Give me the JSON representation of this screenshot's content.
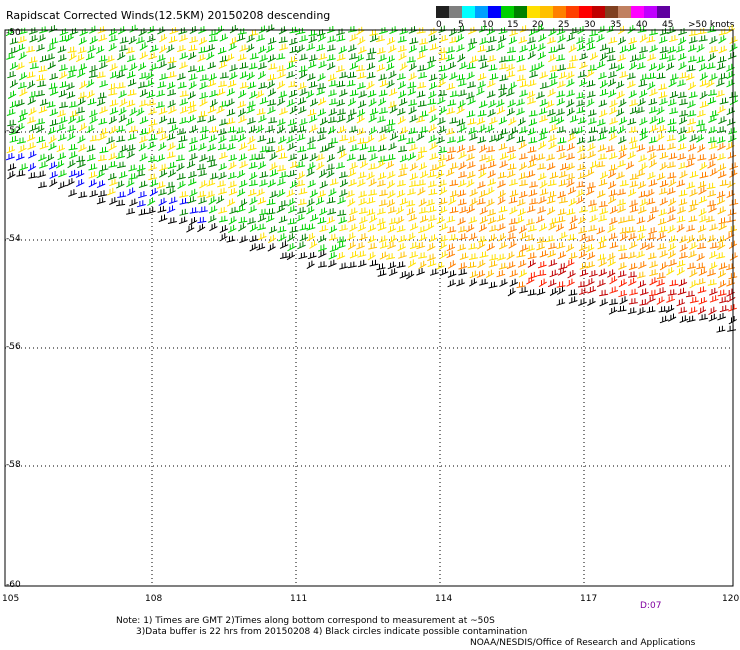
{
  "header": {
    "title": "Rapidscat Corrected Winds(12.5KM) 20150208 descending"
  },
  "legend": {
    "colors": [
      "#202020",
      "#7f7f7f",
      "#00ffff",
      "#00a0ff",
      "#0000ff",
      "#00d000",
      "#008000",
      "#ffe000",
      "#ffc000",
      "#ff8000",
      "#ff4000",
      "#ff0000",
      "#c00000",
      "#804020",
      "#c08060",
      "#ff00ff",
      "#c000ff",
      "#6000a0"
    ],
    "labels": [
      "0",
      "5",
      "10",
      "15",
      "20",
      "25",
      "30",
      "35",
      "40",
      "45",
      ">50 knots"
    ]
  },
  "axes": {
    "lat_labels": [
      "-50",
      "-52",
      "-54",
      "-56",
      "-58",
      "-60"
    ],
    "lon_labels": [
      "105",
      "108",
      "111",
      "114",
      "117",
      "120"
    ]
  },
  "time_label": "D:07",
  "notes": {
    "line1": "Note: 1) Times are GMT 2)Times along bottom correspond to measurement at ~50S",
    "line2": "       3)Data buffer is 22 hrs from 20150208 4) Black circles indicate possible contamination"
  },
  "credit": "NOAA/NESDIS/Office of Research and Applications"
}
